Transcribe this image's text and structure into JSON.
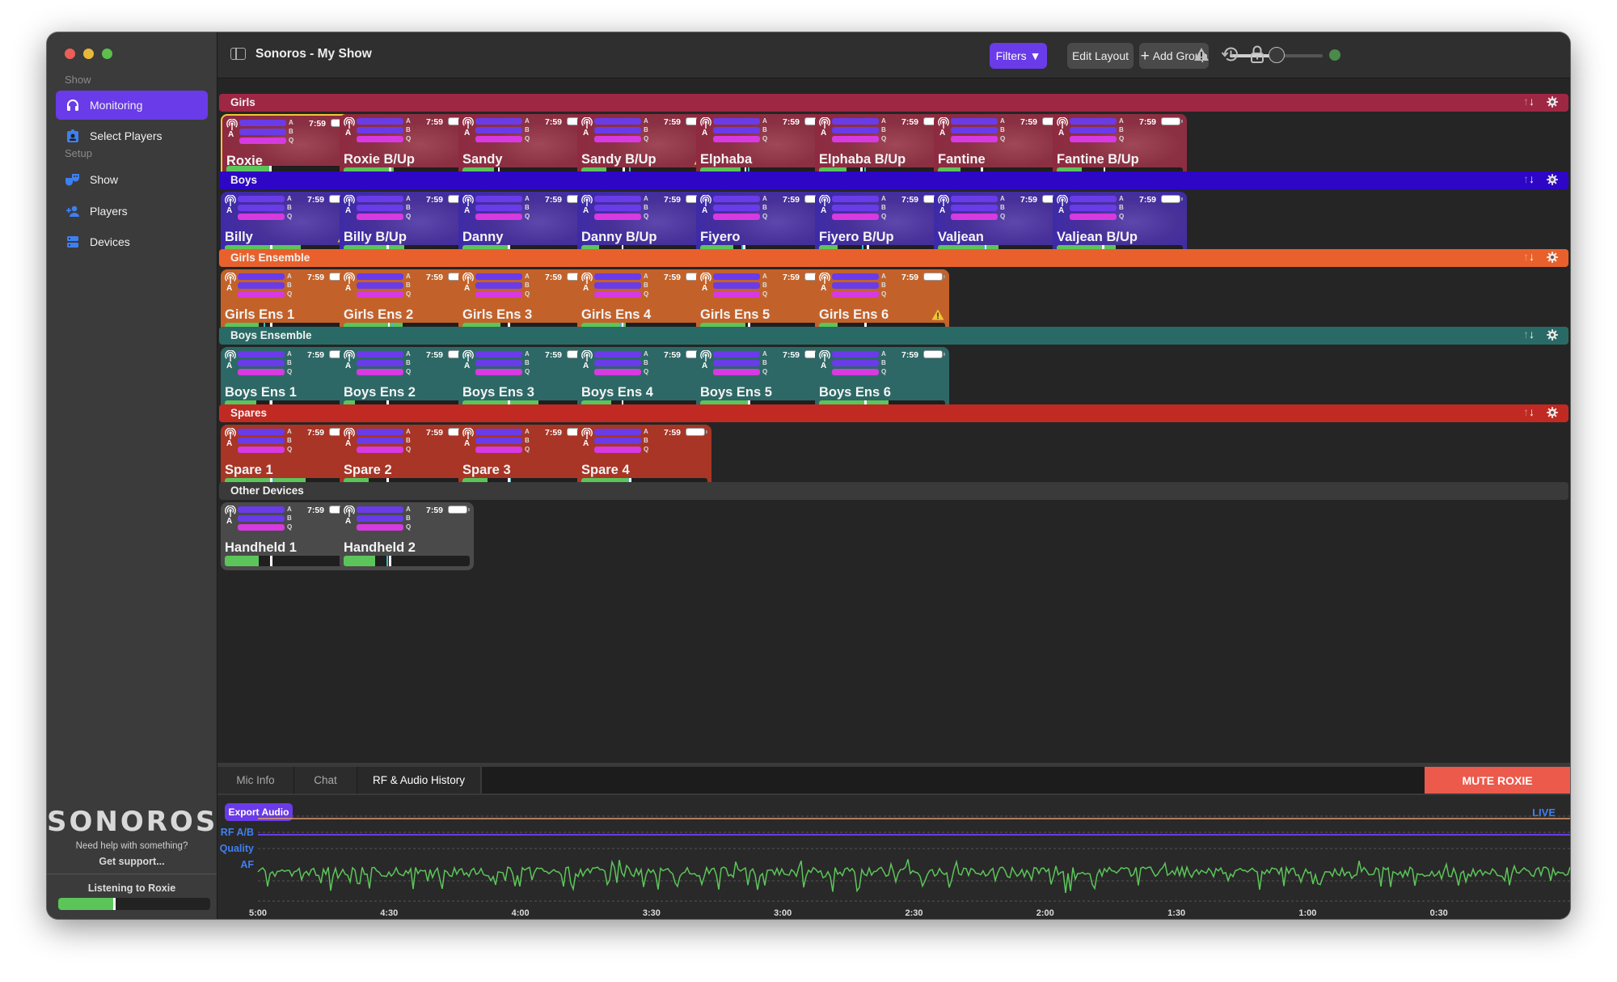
{
  "window": {
    "title": "Sonoros - My Show"
  },
  "sidebar": {
    "sections": [
      {
        "label": "Show",
        "items": [
          {
            "label": "Monitoring",
            "icon": "headphones-icon",
            "active": true
          },
          {
            "label": "Select Players",
            "icon": "badge-icon",
            "active": false
          }
        ]
      },
      {
        "label": "Setup",
        "items": [
          {
            "label": "Show",
            "icon": "theater-masks-icon",
            "active": false
          },
          {
            "label": "Players",
            "icon": "add-person-icon",
            "active": false
          },
          {
            "label": "Devices",
            "icon": "server-icon",
            "active": false
          }
        ]
      }
    ],
    "logo": "SONOROS",
    "help_text": "Need help with something?",
    "support_link": "Get support...",
    "listening_label": "Listening to Roxie",
    "listening_level": 0.38,
    "listening_peak": 0.36
  },
  "toolbar": {
    "filters_label": "Filters ▼",
    "edit_layout_label": "Edit Layout",
    "add_group_label": "Add Group",
    "volume": 0.5,
    "status_color": "#4b8a4b"
  },
  "colors": {
    "accent": "#6a3be8",
    "meter_green": "#5cc55a",
    "bar_q": "#d63ae0",
    "selected_border": "#f3c533",
    "mute_red": "#ec5a4c",
    "live_blue": "#3f80f0"
  },
  "groups": [
    {
      "name": "Girls",
      "header_color": "#9e2744",
      "card_color": "#8e2a40",
      "photos": true,
      "cards": [
        {
          "name": "Roxie",
          "antenna": "A",
          "time": "7:59",
          "level": 0.36,
          "peak": 0.35,
          "selected": true,
          "warning": false
        },
        {
          "name": "Roxie B/Up",
          "antenna": "A",
          "time": "7:59",
          "level": 0.4,
          "peak": 0.36,
          "warning": false
        },
        {
          "name": "Sandy",
          "antenna": "A",
          "time": "7:59",
          "level": 0.25,
          "peak": 0.28,
          "warning": false
        },
        {
          "name": "Sandy B/Up",
          "antenna": "A",
          "time": "7:59",
          "level": 0.2,
          "peak": 0.33,
          "peak2": 0.38,
          "warning": true
        },
        {
          "name": "Elphaba",
          "antenna": "A",
          "time": "7:59",
          "level": 0.32,
          "peak": 0.35,
          "peak2": 0.38,
          "warning": false
        },
        {
          "name": "Elphaba B/Up",
          "antenna": "A",
          "time": "7:59",
          "level": 0.22,
          "peak": 0.33,
          "peak2": 0.36,
          "warning": false
        },
        {
          "name": "Fantine",
          "antenna": "A",
          "time": "7:59",
          "level": 0.18,
          "peak": 0.34,
          "warning": false
        },
        {
          "name": "Fantine B/Up",
          "antenna": "A",
          "time": "7:59",
          "level": 0.2,
          "peak": 0.37,
          "warning": false
        }
      ]
    },
    {
      "name": "Boys",
      "header_color": "#2d06c6",
      "card_color": "#3d2aa8",
      "photos": true,
      "cards": [
        {
          "name": "Billy",
          "antenna": "A",
          "time": "7:59",
          "level": 0.6,
          "peak": 0.36,
          "peak2": 0.35,
          "warning": true
        },
        {
          "name": "Billy B/Up",
          "antenna": "A",
          "time": "7:59",
          "level": 0.48,
          "peak": 0.34,
          "warning": false
        },
        {
          "name": "Danny",
          "antenna": "A",
          "time": "7:59",
          "level": 0.36,
          "peak": 0.36,
          "warning": false
        },
        {
          "name": "Danny B/Up",
          "antenna": "A",
          "time": "7:59",
          "level": 0.14,
          "peak": 0.32,
          "warning": false
        },
        {
          "name": "Fiyero",
          "antenna": "A",
          "time": "7:59",
          "level": 0.26,
          "peak": 0.34,
          "peak2": 0.33,
          "warning": false
        },
        {
          "name": "Fiyero B/Up",
          "antenna": "A",
          "time": "7:59",
          "level": 0.15,
          "peak": 0.38,
          "peak2": 0.34,
          "warning": false
        },
        {
          "name": "Valjean",
          "antenna": "A",
          "time": "7:59",
          "level": 0.48,
          "peak": 0.37,
          "peak2": 0.36,
          "warning": false
        },
        {
          "name": "Valjean B/Up",
          "antenna": "A",
          "time": "7:59",
          "level": 0.47,
          "peak": 0.36,
          "warning": false
        }
      ]
    },
    {
      "name": "Girls Ensemble",
      "header_color": "#e8612c",
      "card_color": "#c2622a",
      "photos": false,
      "cards": [
        {
          "name": "Girls Ens 1",
          "antenna": "A",
          "time": "7:59",
          "level": 0.27,
          "peak": 0.36,
          "peak2": 0.31,
          "warning": false
        },
        {
          "name": "Girls Ens 2",
          "antenna": "A",
          "time": "7:59",
          "level": 0.47,
          "peak": 0.35,
          "peak2": 0.38,
          "warning": false
        },
        {
          "name": "Girls Ens 3",
          "antenna": "A",
          "time": "7:59",
          "level": 0.3,
          "peak": 0.36,
          "warning": false
        },
        {
          "name": "Girls Ens 4",
          "antenna": "A",
          "time": "7:59",
          "level": 0.35,
          "peak": 0.32,
          "peak2": 0.3,
          "warning": false
        },
        {
          "name": "Girls Ens 5",
          "antenna": "A",
          "time": "7:59",
          "level": 0.36,
          "peak": 0.38,
          "warning": false
        },
        {
          "name": "Girls Ens 6",
          "antenna": "A",
          "time": "7:59",
          "level": 0.15,
          "peak": 0.36,
          "warning": true
        }
      ]
    },
    {
      "name": "Boys Ensemble",
      "header_color": "#2a6a66",
      "card_color": "#2d6866",
      "photos": false,
      "cards": [
        {
          "name": "Boys Ens 1",
          "antenna": "A",
          "time": "7:59",
          "level": 0.25,
          "peak": 0.36,
          "peak2": 0.35,
          "warning": false
        },
        {
          "name": "Boys Ens 2",
          "antenna": "A",
          "time": "7:59",
          "level": 0.09,
          "peak": 0.34,
          "warning": false
        },
        {
          "name": "Boys Ens 3",
          "antenna": "A",
          "time": "7:59",
          "level": 0.6,
          "peak": 0.36,
          "warning": false
        },
        {
          "name": "Boys Ens 4",
          "antenna": "A",
          "time": "7:59",
          "level": 0.24,
          "peak": 0.32,
          "warning": false
        },
        {
          "name": "Boys Ens 5",
          "antenna": "A",
          "time": "7:59",
          "level": 0.38,
          "peak": 0.38,
          "warning": false
        },
        {
          "name": "Boys Ens 6",
          "antenna": "A",
          "time": "7:59",
          "level": 0.55,
          "peak": 0.36,
          "warning": false
        }
      ]
    },
    {
      "name": "Spares",
      "header_color": "#c02a22",
      "card_color": "#a83526",
      "photos": false,
      "cards": [
        {
          "name": "Spare 1",
          "antenna": "A",
          "time": "7:59",
          "level": 0.64,
          "peak": 0.36,
          "peak2": 0.38,
          "warning": false
        },
        {
          "name": "Spare 2",
          "antenna": "A",
          "time": "7:59",
          "level": 0.2,
          "peak": 0.34,
          "warning": false
        },
        {
          "name": "Spare 3",
          "antenna": "A",
          "time": "7:59",
          "level": 0.2,
          "peak": 0.36,
          "peak2": 0.37,
          "warning": false
        },
        {
          "name": "Spare 4",
          "antenna": "A",
          "time": "7:59",
          "level": 0.39,
          "peak": 0.38,
          "peak2": 0.37,
          "warning": false
        }
      ]
    },
    {
      "name": "Other Devices",
      "header_color": "#3a3a3a",
      "card_color": "#4a4a4a",
      "photos": false,
      "cards": [
        {
          "name": "Handheld 1",
          "antenna": "A",
          "time": "7:59",
          "level": 0.27,
          "peak": 0.36,
          "warning": false
        },
        {
          "name": "Handheld 2",
          "antenna": "A",
          "time": "7:59",
          "level": 0.25,
          "peak": 0.36,
          "peak2": 0.34,
          "warning": false
        }
      ]
    }
  ],
  "bar_labels": {
    "a": "A",
    "b": "B",
    "q": "Q"
  },
  "bottom_panel": {
    "tabs": [
      {
        "label": "Mic Info",
        "active": false
      },
      {
        "label": "Chat",
        "active": false
      },
      {
        "label": "RF & Audio History",
        "active": true
      }
    ],
    "mute_label": "MUTE ROXIE",
    "export_label": "Export Audio",
    "live_label": "LIVE"
  },
  "chart_data": {
    "type": "line",
    "title": "RF & Audio History",
    "rows": [
      "RF A/B",
      "Quality",
      "AF"
    ],
    "x_ticks": [
      "5:00",
      "4:30",
      "4:00",
      "3:30",
      "3:00",
      "2:30",
      "2:00",
      "1:30",
      "1:00",
      "0:30"
    ],
    "xlim_seconds_ago": [
      300,
      0
    ],
    "series": [
      {
        "name": "RF A/B",
        "color": "#e39a6a",
        "value": "constant high"
      },
      {
        "name": "Quality",
        "color": "#6a3be8",
        "value": "constant high"
      },
      {
        "name": "AF",
        "color": "#5cc55a",
        "value": "noisy audio level, roughly 0.55-0.85 of row range"
      }
    ],
    "grid": true
  }
}
